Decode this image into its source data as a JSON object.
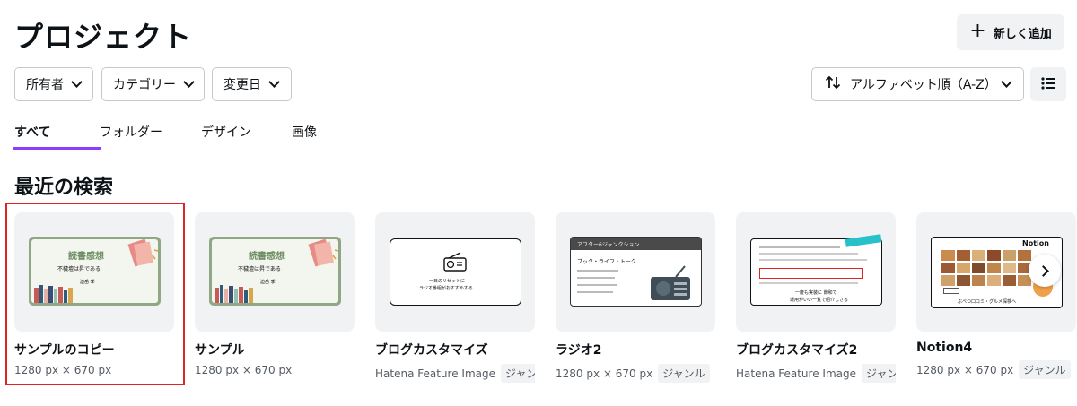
{
  "header": {
    "title": "プロジェクト",
    "add_label": "新しく追加"
  },
  "filters": [
    {
      "label": "所有者"
    },
    {
      "label": "カテゴリー"
    },
    {
      "label": "変更日"
    }
  ],
  "sort": {
    "label": "アルファベット順（A-Z）"
  },
  "tabs": [
    {
      "label": "すべて",
      "active": true
    },
    {
      "label": "フォルダー"
    },
    {
      "label": "デザイン"
    },
    {
      "label": "画像"
    }
  ],
  "section": {
    "title": "最近の検索"
  },
  "cards": [
    {
      "title": "サンプルのコピー",
      "meta": "1280 px × 670 px",
      "genre": "",
      "selected": true,
      "thumb": {
        "heading": "読書感想",
        "sub": "不穢壇は昇である",
        "author": "迫岳 季"
      }
    },
    {
      "title": "サンプル",
      "meta": "1280 px × 670 px",
      "genre": "",
      "thumb": {
        "heading": "読書感想",
        "sub": "不穢壇は昇である",
        "author": "迫岳 季"
      }
    },
    {
      "title": "ブログカスタマイズ",
      "meta": "Hatena Feature Image",
      "genre": "ジャンル",
      "thumb": {
        "line1": "一日のリセットに",
        "line2": "ラジオ番組がおすすめする"
      }
    },
    {
      "title": "ラジオ2",
      "meta": "1280 px × 670 px",
      "genre": "ジャンル",
      "thumb": {
        "header": "アフター6ジャンクション",
        "sub": "ブック・ライフ・トーク"
      }
    },
    {
      "title": "ブログカスタマイズ2",
      "meta": "Hatena Feature Image",
      "genre": "ジャンル",
      "thumb": {
        "line1": "一度も実装に 飽和で",
        "line2": "運用がいい一覧で紹介しさる"
      }
    },
    {
      "title": "Notion4",
      "meta": "1280 px × 670 px",
      "genre": "ジャンル",
      "thumb": {
        "logo": "Notion",
        "caption": "ぶべつ口コミ・グルメ探検へ"
      }
    }
  ],
  "colors": {
    "accent": "#8b3dff",
    "selection": "#e02424",
    "book_green": "#8fa785"
  }
}
